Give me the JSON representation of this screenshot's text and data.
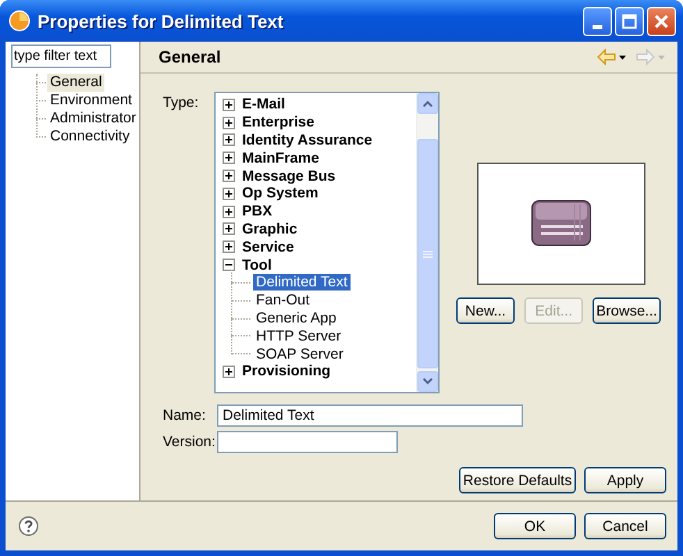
{
  "window": {
    "title": "Properties for Delimited Text"
  },
  "filter": {
    "placeholder": "type filter text"
  },
  "nav": [
    {
      "label": "General",
      "selected": true
    },
    {
      "label": "Environment",
      "selected": false
    },
    {
      "label": "Administrator",
      "selected": false
    },
    {
      "label": "Connectivity",
      "selected": false
    }
  ],
  "page": {
    "title": "General"
  },
  "type_label": "Type:",
  "type_tree": [
    {
      "label": "E-Mail",
      "expanded": false,
      "selected": false
    },
    {
      "label": "Enterprise",
      "expanded": false,
      "selected": false
    },
    {
      "label": "Identity Assurance",
      "expanded": false,
      "selected": false
    },
    {
      "label": "MainFrame",
      "expanded": false,
      "selected": false
    },
    {
      "label": "Message Bus",
      "expanded": false,
      "selected": false
    },
    {
      "label": "Op System",
      "expanded": false,
      "selected": false
    },
    {
      "label": "PBX",
      "expanded": false,
      "selected": false
    },
    {
      "label": "Graphic",
      "expanded": false,
      "selected": false
    },
    {
      "label": "Service",
      "expanded": false,
      "selected": false
    },
    {
      "label": "Tool",
      "expanded": true,
      "selected": false,
      "children": [
        {
          "label": "Delimited Text",
          "selected": true
        },
        {
          "label": "Fan-Out",
          "selected": false
        },
        {
          "label": "Generic App",
          "selected": false
        },
        {
          "label": "HTTP Server",
          "selected": false
        },
        {
          "label": "SOAP Server",
          "selected": false
        }
      ]
    },
    {
      "label": "Provisioning",
      "expanded": false,
      "selected": false
    }
  ],
  "preview_buttons": [
    {
      "label": "New...",
      "disabled": false
    },
    {
      "label": "Edit...",
      "disabled": true
    },
    {
      "label": "Browse...",
      "disabled": false
    }
  ],
  "fields": [
    {
      "label": "Name:",
      "value": "Delimited Text"
    },
    {
      "label": "Version:"
    }
  ],
  "page_buttons": [
    "Restore Defaults",
    "Apply"
  ],
  "dialog_buttons": [
    "OK",
    "Cancel"
  ]
}
